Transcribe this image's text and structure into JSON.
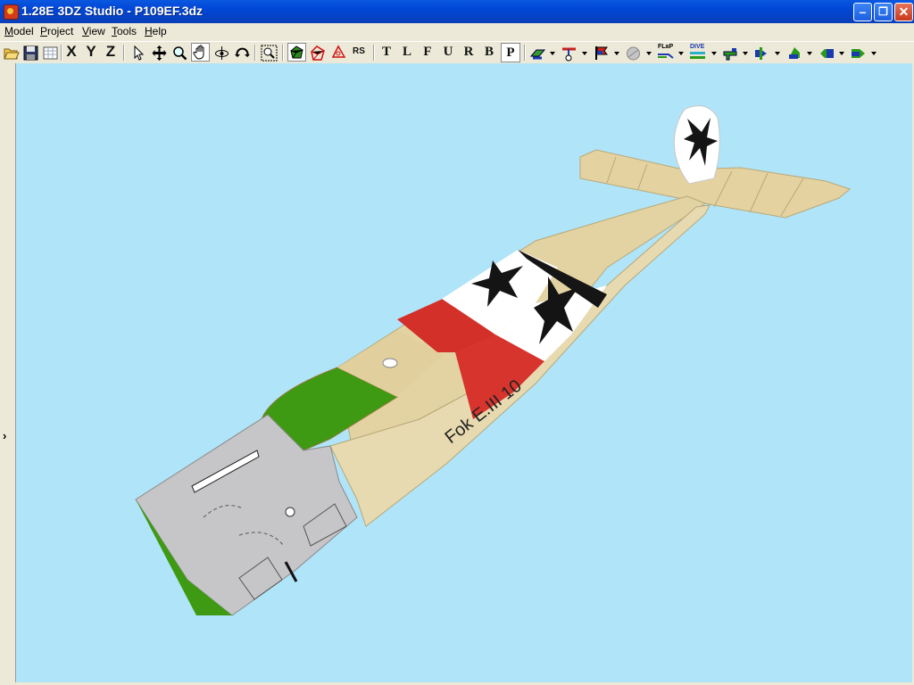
{
  "window": {
    "title": "1.28E 3DZ Studio - P109EF.3dz",
    "controls": [
      "minimize",
      "maximize",
      "close"
    ]
  },
  "menu": {
    "items": [
      {
        "label": "Model",
        "ul": "M",
        "rest": "odel"
      },
      {
        "label": "Project",
        "ul": "P",
        "rest": "roject"
      },
      {
        "label": "View",
        "ul": "V",
        "rest": "iew"
      },
      {
        "label": "Tools",
        "ul": "T",
        "rest": "ools"
      },
      {
        "label": "Help",
        "ul": "H",
        "rest": "elp"
      }
    ]
  },
  "toolbar": {
    "axis_buttons": [
      "X",
      "Y",
      "Z"
    ],
    "view_letters": [
      "T",
      "L",
      "F",
      "U",
      "R",
      "B",
      "P"
    ],
    "pressed_view": "P",
    "rs_label": "RS",
    "flap_label": "FLaP",
    "dive_label": "DIVE"
  },
  "model": {
    "fuselage_text": "Fok E.III 10"
  },
  "colors": {
    "viewport_bg": "#b0e4f8",
    "fabric": "#e2d2a2",
    "cowl": "#c6c6c8",
    "green": "#3e9a12",
    "red": "#d3302a"
  }
}
